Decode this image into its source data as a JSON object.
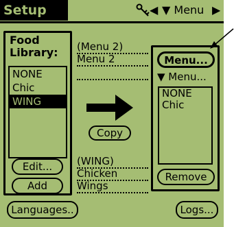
{
  "titlebar": {
    "title": "Setup",
    "menu_arrow_label": "▼ Menu",
    "left_arrow": "◀",
    "right_arrow": "▶"
  },
  "food_library": {
    "label_line1": "Food",
    "label_line2": "Library:",
    "items": [
      {
        "label": "NONE",
        "selected": false
      },
      {
        "label": "Chic",
        "selected": false
      },
      {
        "label": "WING",
        "selected": true
      }
    ],
    "edit_button": "Edit...",
    "add_button": "Add"
  },
  "middle": {
    "top_line1": "(Menu 2)",
    "top_line2": "Menu 2",
    "copy_button": "Copy",
    "bottom_line1": "(WING)",
    "bottom_line2": "Chicken",
    "bottom_line3": "Wings"
  },
  "menu_panel": {
    "menu_button": "Menu...",
    "dropdown_label": "▼ Menu...",
    "items": [
      {
        "label": "NONE"
      },
      {
        "label": "Chic"
      }
    ],
    "remove_button": "Remove"
  },
  "footer": {
    "languages_button": "Languages..",
    "logs_button": "Logs..."
  }
}
